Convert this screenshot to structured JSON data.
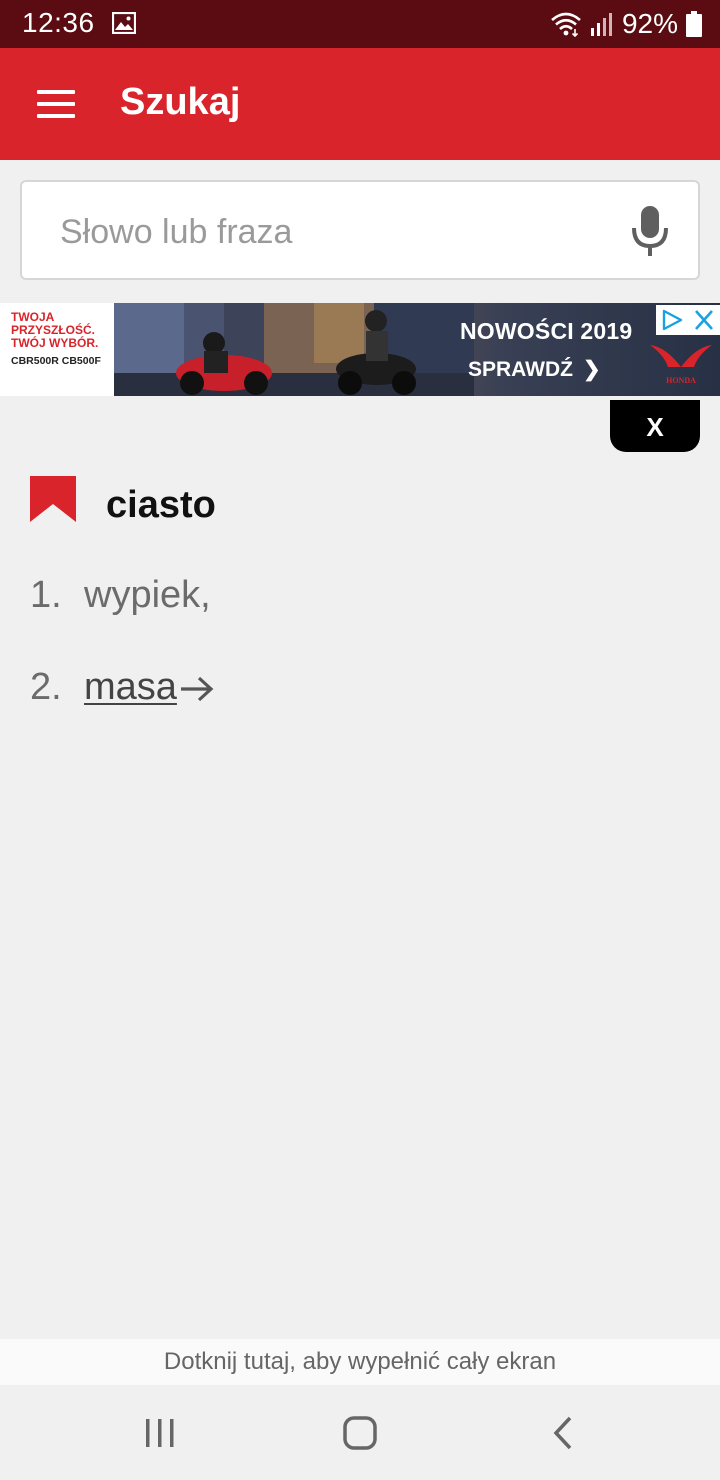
{
  "status_bar": {
    "time": "12:36",
    "battery_percent": "92%",
    "icons": [
      "gallery-icon",
      "wifi-icon",
      "signal-icon",
      "battery-icon"
    ]
  },
  "app_bar": {
    "title": "Szukaj",
    "menu_icon": "hamburger-menu-icon",
    "color": "#d9242b"
  },
  "search": {
    "placeholder": "Słowo lub fraza",
    "value": "",
    "mic_icon": "microphone-icon"
  },
  "ad": {
    "slogan": "TWOJA PRZYSZŁOŚĆ. TWÓJ WYBÓR.",
    "models": "CBR500R CB500F",
    "headline": "NOWOŚCI 2019",
    "cta": "SPRAWDŹ",
    "brand": "HONDA",
    "dismiss_label": "X"
  },
  "entry": {
    "word": "ciasto",
    "bookmark_icon": "bookmark-icon",
    "meanings": [
      {
        "number": "1.",
        "text": "wypiek,"
      },
      {
        "number": "2.",
        "text": "masa",
        "link": true
      }
    ]
  },
  "footer": {
    "fullscreen_hint": "Dotknij tutaj, aby wypełnić cały ekran"
  },
  "nav_bar": {
    "buttons": [
      "recent-apps-icon",
      "home-icon",
      "back-icon"
    ]
  },
  "colors": {
    "status_bar": "#5a0c12",
    "accent": "#d9242b",
    "background": "#f0f0f0"
  }
}
